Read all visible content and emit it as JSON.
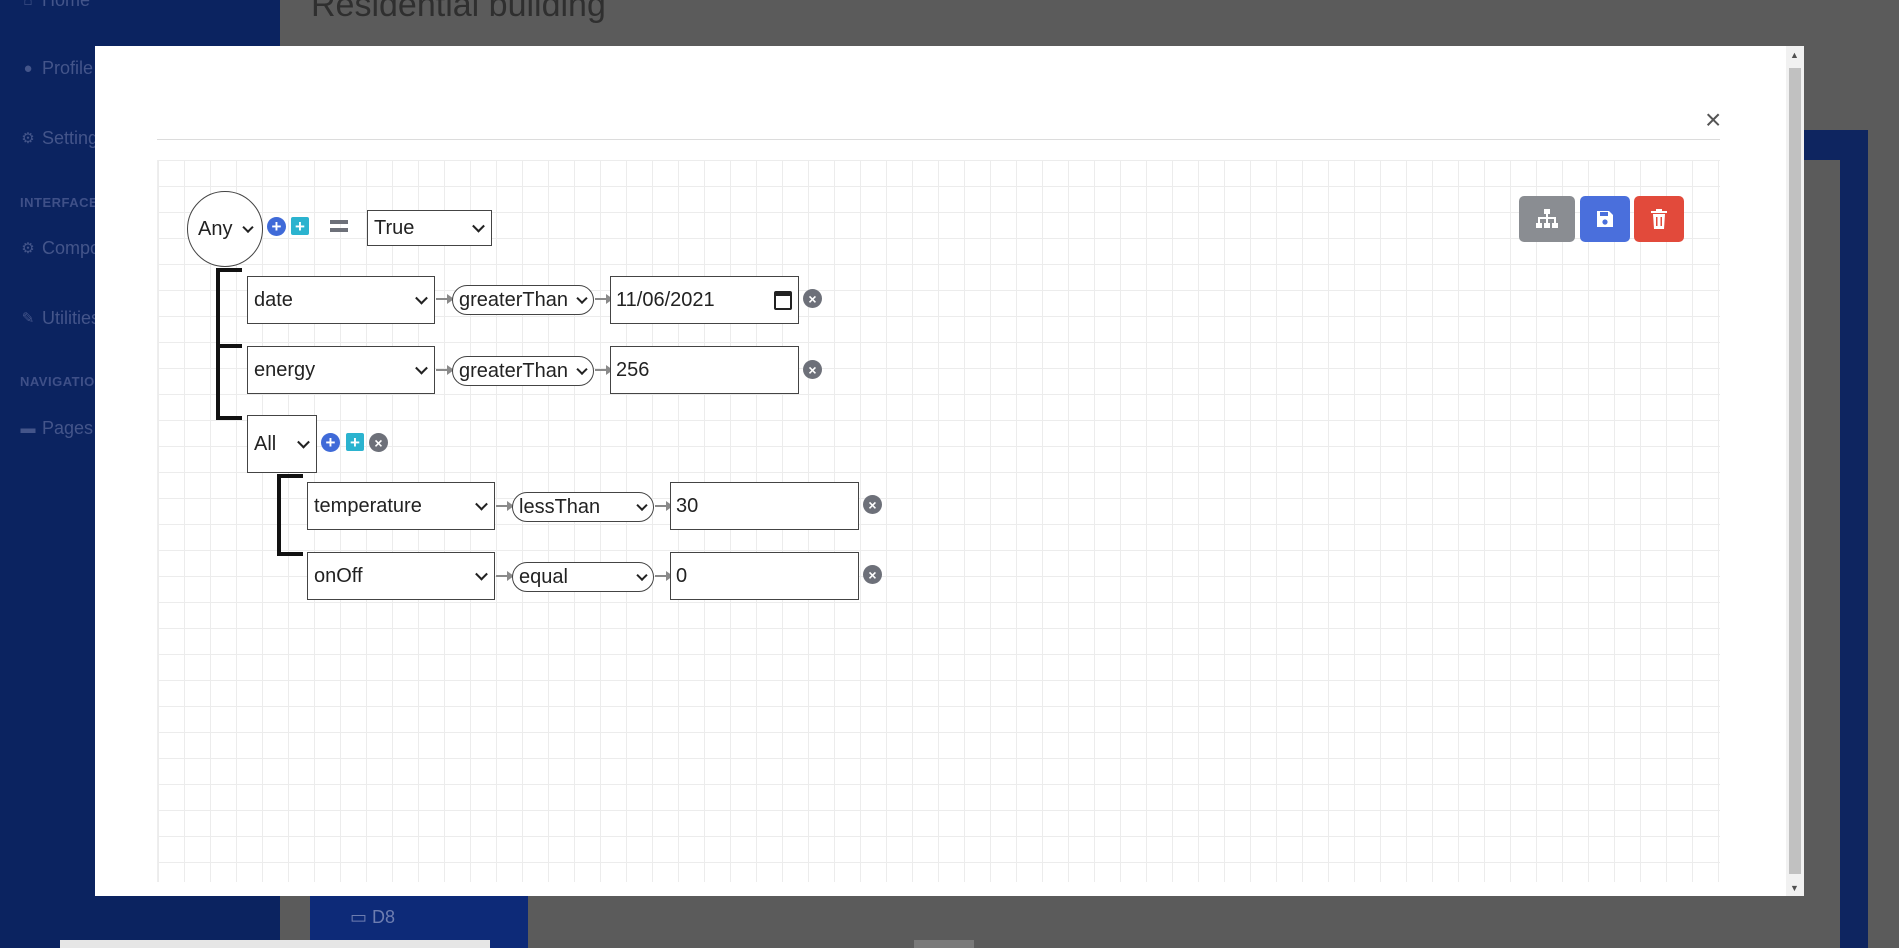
{
  "background": {
    "page_title": "Residential building",
    "sidebar": {
      "items": [
        {
          "label": "Home",
          "icon": "home-icon"
        },
        {
          "label": "Profile",
          "icon": "user-icon"
        },
        {
          "label": "Settings",
          "icon": "gear-icon"
        },
        {
          "label": "Components",
          "icon": "gear-icon"
        },
        {
          "label": "Utilities",
          "icon": "wrench-icon"
        },
        {
          "label": "Pages",
          "icon": "folder-icon"
        }
      ],
      "headings": [
        "INTERFACE",
        "NAVIGATION"
      ]
    },
    "submenu_item": {
      "label": "D8",
      "icon": "bed-icon"
    }
  },
  "modal": {
    "close_label": "×",
    "toolbar": {
      "tree_button": "sitemap-icon",
      "save_button": "save-icon",
      "delete_button": "trash-icon",
      "colors": {
        "tree": "#8a8d92",
        "save": "#4a6fdc",
        "delete": "#e24a3b"
      }
    },
    "rule": {
      "root_group": {
        "combinator": "Any",
        "equals_symbol": "=",
        "value": "True",
        "conditions": [
          {
            "field": "date",
            "operator": "greaterThan",
            "value": "11/06/2021"
          },
          {
            "field": "energy",
            "operator": "greaterThan",
            "value": "256"
          }
        ],
        "sub_group": {
          "combinator": "All",
          "conditions": [
            {
              "field": "temperature",
              "operator": "lessThan",
              "value": "30"
            },
            {
              "field": "onOff",
              "operator": "equal",
              "value": "0"
            }
          ]
        }
      }
    }
  }
}
